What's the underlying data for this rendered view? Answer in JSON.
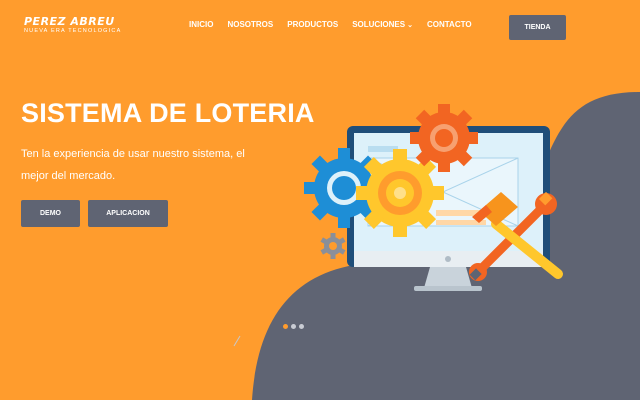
{
  "header": {
    "logo_title": "PEREZ ABREU",
    "logo_subtitle": "NUEVA ERA TECNOLOGICA",
    "nav": [
      {
        "label": "INICIO",
        "name": "nav-inicio"
      },
      {
        "label": "NOSOTROS",
        "name": "nav-nosotros"
      },
      {
        "label": "PRODUCTOS",
        "name": "nav-productos"
      },
      {
        "label": "SOLUCIONES",
        "name": "nav-soluciones",
        "dropdown": true
      },
      {
        "label": "CONTACTO",
        "name": "nav-contacto"
      }
    ],
    "cta_label": "TIENDA"
  },
  "hero": {
    "title": "SISTEMA DE LOTERIA",
    "description": "Ten la experiencia de usar nuestro sistema, el mejor del mercado.",
    "buttons": {
      "demo": "DEMO",
      "app": "APLICACION"
    }
  },
  "carousel": {
    "slides": 3,
    "active_index": 0
  },
  "illustration_icons": [
    "computer-monitor-icon",
    "gear-icon",
    "hammer-icon",
    "wrench-icon"
  ],
  "colors": {
    "background": "#FF9C2D",
    "button": "#5F6473",
    "wave": "#5F6473",
    "gear_orange": "#F26522",
    "gear_yellow": "#FFC72C",
    "gear_blue": "#1E8ED6",
    "monitor_frame": "#1F4E79",
    "monitor_screen": "#DDF1FA"
  }
}
